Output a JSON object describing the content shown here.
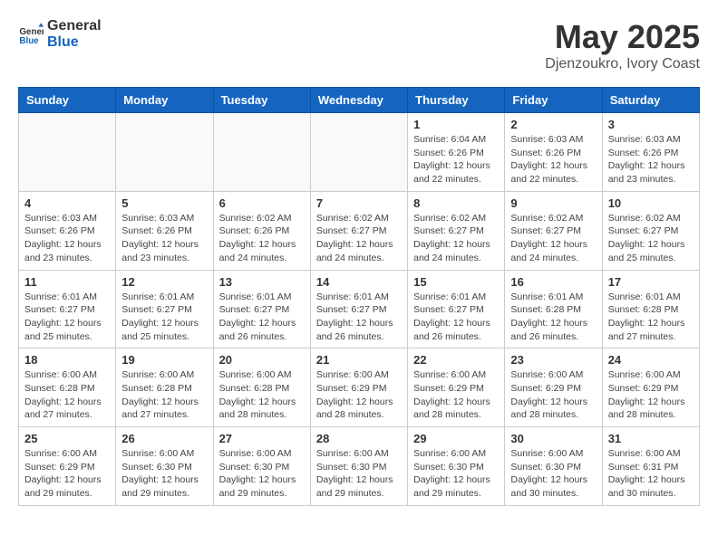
{
  "header": {
    "logo_general": "General",
    "logo_blue": "Blue",
    "month_year": "May 2025",
    "location": "Djenzoukro, Ivory Coast"
  },
  "weekdays": [
    "Sunday",
    "Monday",
    "Tuesday",
    "Wednesday",
    "Thursday",
    "Friday",
    "Saturday"
  ],
  "weeks": [
    [
      {
        "day": "",
        "info": ""
      },
      {
        "day": "",
        "info": ""
      },
      {
        "day": "",
        "info": ""
      },
      {
        "day": "",
        "info": ""
      },
      {
        "day": "1",
        "info": "Sunrise: 6:04 AM\nSunset: 6:26 PM\nDaylight: 12 hours\nand 22 minutes."
      },
      {
        "day": "2",
        "info": "Sunrise: 6:03 AM\nSunset: 6:26 PM\nDaylight: 12 hours\nand 22 minutes."
      },
      {
        "day": "3",
        "info": "Sunrise: 6:03 AM\nSunset: 6:26 PM\nDaylight: 12 hours\nand 23 minutes."
      }
    ],
    [
      {
        "day": "4",
        "info": "Sunrise: 6:03 AM\nSunset: 6:26 PM\nDaylight: 12 hours\nand 23 minutes."
      },
      {
        "day": "5",
        "info": "Sunrise: 6:03 AM\nSunset: 6:26 PM\nDaylight: 12 hours\nand 23 minutes."
      },
      {
        "day": "6",
        "info": "Sunrise: 6:02 AM\nSunset: 6:26 PM\nDaylight: 12 hours\nand 24 minutes."
      },
      {
        "day": "7",
        "info": "Sunrise: 6:02 AM\nSunset: 6:27 PM\nDaylight: 12 hours\nand 24 minutes."
      },
      {
        "day": "8",
        "info": "Sunrise: 6:02 AM\nSunset: 6:27 PM\nDaylight: 12 hours\nand 24 minutes."
      },
      {
        "day": "9",
        "info": "Sunrise: 6:02 AM\nSunset: 6:27 PM\nDaylight: 12 hours\nand 24 minutes."
      },
      {
        "day": "10",
        "info": "Sunrise: 6:02 AM\nSunset: 6:27 PM\nDaylight: 12 hours\nand 25 minutes."
      }
    ],
    [
      {
        "day": "11",
        "info": "Sunrise: 6:01 AM\nSunset: 6:27 PM\nDaylight: 12 hours\nand 25 minutes."
      },
      {
        "day": "12",
        "info": "Sunrise: 6:01 AM\nSunset: 6:27 PM\nDaylight: 12 hours\nand 25 minutes."
      },
      {
        "day": "13",
        "info": "Sunrise: 6:01 AM\nSunset: 6:27 PM\nDaylight: 12 hours\nand 26 minutes."
      },
      {
        "day": "14",
        "info": "Sunrise: 6:01 AM\nSunset: 6:27 PM\nDaylight: 12 hours\nand 26 minutes."
      },
      {
        "day": "15",
        "info": "Sunrise: 6:01 AM\nSunset: 6:27 PM\nDaylight: 12 hours\nand 26 minutes."
      },
      {
        "day": "16",
        "info": "Sunrise: 6:01 AM\nSunset: 6:28 PM\nDaylight: 12 hours\nand 26 minutes."
      },
      {
        "day": "17",
        "info": "Sunrise: 6:01 AM\nSunset: 6:28 PM\nDaylight: 12 hours\nand 27 minutes."
      }
    ],
    [
      {
        "day": "18",
        "info": "Sunrise: 6:00 AM\nSunset: 6:28 PM\nDaylight: 12 hours\nand 27 minutes."
      },
      {
        "day": "19",
        "info": "Sunrise: 6:00 AM\nSunset: 6:28 PM\nDaylight: 12 hours\nand 27 minutes."
      },
      {
        "day": "20",
        "info": "Sunrise: 6:00 AM\nSunset: 6:28 PM\nDaylight: 12 hours\nand 28 minutes."
      },
      {
        "day": "21",
        "info": "Sunrise: 6:00 AM\nSunset: 6:29 PM\nDaylight: 12 hours\nand 28 minutes."
      },
      {
        "day": "22",
        "info": "Sunrise: 6:00 AM\nSunset: 6:29 PM\nDaylight: 12 hours\nand 28 minutes."
      },
      {
        "day": "23",
        "info": "Sunrise: 6:00 AM\nSunset: 6:29 PM\nDaylight: 12 hours\nand 28 minutes."
      },
      {
        "day": "24",
        "info": "Sunrise: 6:00 AM\nSunset: 6:29 PM\nDaylight: 12 hours\nand 28 minutes."
      }
    ],
    [
      {
        "day": "25",
        "info": "Sunrise: 6:00 AM\nSunset: 6:29 PM\nDaylight: 12 hours\nand 29 minutes."
      },
      {
        "day": "26",
        "info": "Sunrise: 6:00 AM\nSunset: 6:30 PM\nDaylight: 12 hours\nand 29 minutes."
      },
      {
        "day": "27",
        "info": "Sunrise: 6:00 AM\nSunset: 6:30 PM\nDaylight: 12 hours\nand 29 minutes."
      },
      {
        "day": "28",
        "info": "Sunrise: 6:00 AM\nSunset: 6:30 PM\nDaylight: 12 hours\nand 29 minutes."
      },
      {
        "day": "29",
        "info": "Sunrise: 6:00 AM\nSunset: 6:30 PM\nDaylight: 12 hours\nand 29 minutes."
      },
      {
        "day": "30",
        "info": "Sunrise: 6:00 AM\nSunset: 6:30 PM\nDaylight: 12 hours\nand 30 minutes."
      },
      {
        "day": "31",
        "info": "Sunrise: 6:00 AM\nSunset: 6:31 PM\nDaylight: 12 hours\nand 30 minutes."
      }
    ]
  ]
}
